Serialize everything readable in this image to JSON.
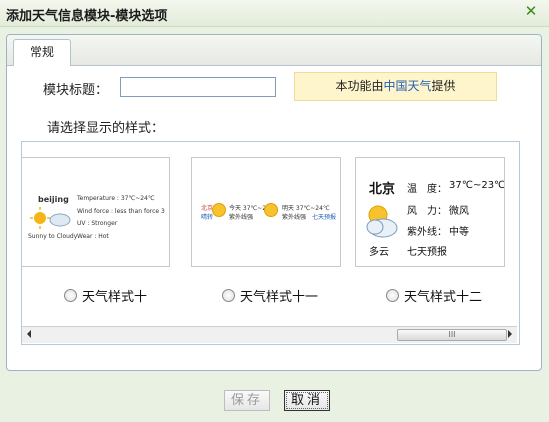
{
  "window": {
    "title": "添加天气信息模块-模块选项"
  },
  "tabs": [
    {
      "label": "常规"
    }
  ],
  "form": {
    "title_label": "模块标题：",
    "title_value": "",
    "notice_prefix": "本功能由",
    "notice_link": "中国天气",
    "notice_suffix": "提供",
    "style_label": "请选择显示的样式："
  },
  "styles": [
    {
      "label": "天气样式十",
      "preview": {
        "city": "beijing",
        "temp": "Temperature : 37℃~24℃",
        "wind": "Wind force : less than force 3",
        "uv": "UV : Stronger",
        "cond": "Sunny to Cloudy",
        "wear": "Wear : Hot"
      }
    },
    {
      "label": "天气样式十一",
      "preview": {
        "city": "北京",
        "cond": "晴转",
        "day1": "今天 37℃~24℃",
        "day1b": "紫外线强",
        "day2": "明天 37℃~24℃",
        "day2b": "紫外线强",
        "more": "七天预报"
      }
    },
    {
      "label": "天气样式十二",
      "preview": {
        "city": "北京",
        "temp_label": "温　度：",
        "temp": "37℃~23℃",
        "wind_label": "风　力：",
        "wind": "微风",
        "uv_label": "紫外线：",
        "uv": "中等",
        "cond": "多云",
        "forecast": "七天预报"
      }
    }
  ],
  "scrollbar": {
    "thumb_grip": "III"
  },
  "buttons": {
    "save": "保存",
    "cancel": "取消"
  },
  "colors": {
    "link": "#1f5fb4",
    "notice_bg": "#fff5cc",
    "close": "#3a8a1a"
  },
  "icons": {
    "close": "close-icon",
    "weather": "sun-cloud-icon"
  }
}
